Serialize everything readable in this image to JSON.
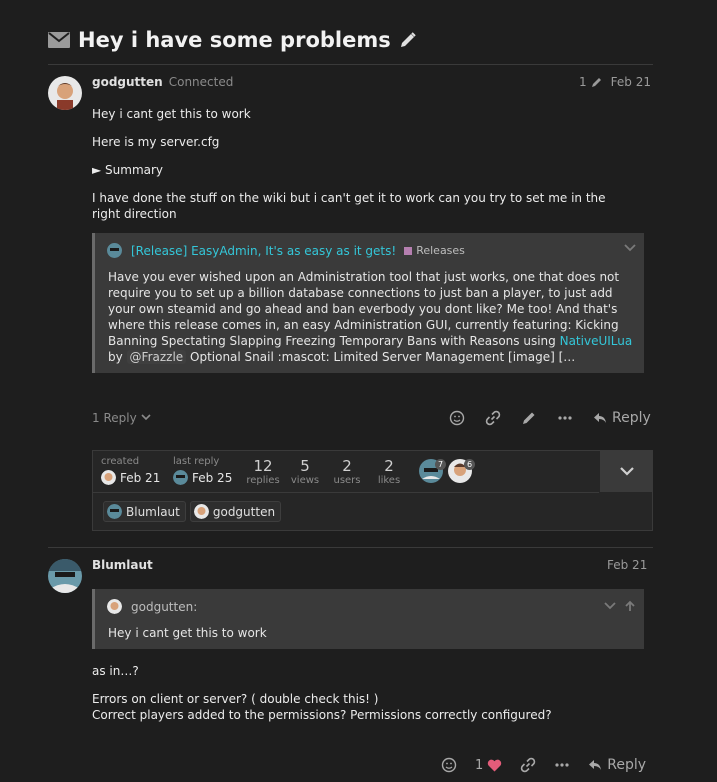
{
  "topic": {
    "title": "Hey i have some problems"
  },
  "post1": {
    "username": "godgutten",
    "status": "Connected",
    "edit_count": "1",
    "date": "Feb 21",
    "lines": [
      "Hey i cant get this to work",
      "Here is my server.cfg"
    ],
    "summary_label": "► Summary",
    "paragraph": "I have done the stuff on the wiki but i can't get it to work can you try to set me in the right direction",
    "onebox": {
      "title": "[Release] EasyAdmin, It's as easy as it gets!",
      "category": "Releases",
      "category_color": "#b57fb0",
      "text_pre": "Have you ever wished upon an Administration tool that just works, one that does not require you to set up a billion database connections to just ban a player, to just add your own steamid and go ahead and ban everbody you dont like? Me too! And that's where this release comes in, an easy Administration GUI, currently featuring: Kicking Banning Spectating Slapping Freezing Temporary Bans with Reasons using ",
      "link": "NativeUILua",
      "by": " by ",
      "mention": "@Frazzle",
      "text_post": " Optional Snail :mascot: Limited Server Management [image] […"
    },
    "replies_label": "1 Reply",
    "reply_label": "Reply"
  },
  "topic_map": {
    "created_label": "created",
    "created_date": "Feb 21",
    "last_reply_label": "last reply",
    "last_reply_date": "Feb 25",
    "stats": [
      {
        "num": "12",
        "label": "replies"
      },
      {
        "num": "5",
        "label": "views"
      },
      {
        "num": "2",
        "label": "users"
      },
      {
        "num": "2",
        "label": "likes"
      }
    ],
    "participant_counts": [
      "7",
      "6"
    ],
    "links": [
      "Blumlaut",
      "godgutten"
    ]
  },
  "post2": {
    "username": "Blumlaut",
    "date": "Feb 21",
    "quote_author": "godgutten:",
    "quote_text": "Hey i cant get this to work",
    "lines": [
      "as in…?",
      "Errors on client or server? ( double check this! )",
      "Correct players added to the permissions? Permissions correctly configured?"
    ],
    "like_count": "1",
    "reply_label": "Reply"
  },
  "colors": {
    "accent": "#34c7d9",
    "background": "#1e1e1e",
    "like": "#e45c7a"
  }
}
